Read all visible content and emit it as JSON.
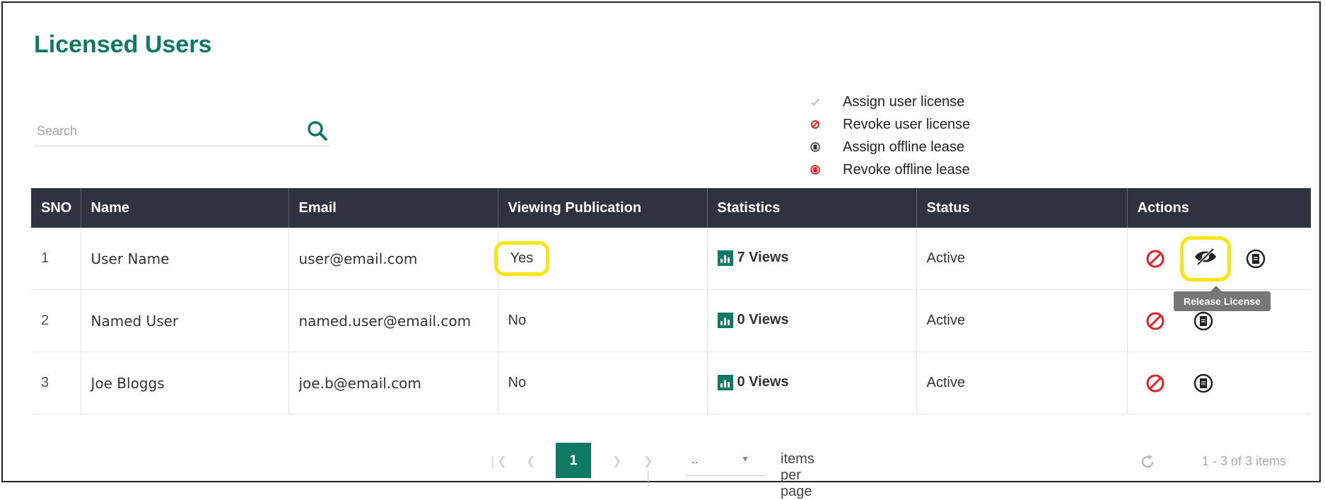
{
  "page": {
    "title": "Licensed Users"
  },
  "search": {
    "placeholder": "Search",
    "value": ""
  },
  "legend": [
    {
      "icon": "check-icon",
      "label": "Assign user license"
    },
    {
      "icon": "revoke-icon",
      "label": "Revoke user license"
    },
    {
      "icon": "offline-lease-icon",
      "label": "Assign offline lease"
    },
    {
      "icon": "revoke-offline-lease-icon",
      "label": "Revoke offline lease"
    }
  ],
  "table": {
    "headers": [
      "SNO",
      "Name",
      "Email",
      "Viewing Publication",
      "Statistics",
      "Status",
      "Actions"
    ],
    "rows": [
      {
        "sno": "1",
        "name": "User Name",
        "email": "user@email.com",
        "viewing": "Yes",
        "statistics": "7 Views",
        "status": "Active"
      },
      {
        "sno": "2",
        "name": "Named User",
        "email": "named.user@email.com",
        "viewing": "No",
        "statistics": "0 Views",
        "status": "Active"
      },
      {
        "sno": "3",
        "name": "Joe Bloggs",
        "email": "joe.b@email.com",
        "viewing": "No",
        "statistics": "0 Views",
        "status": "Active"
      }
    ]
  },
  "tooltip": {
    "text": "Release License"
  },
  "pagination": {
    "current_page": "1",
    "per_page_value": "..",
    "items_per_page_label": "items per page",
    "range_text": "1 - 3 of 3 items"
  },
  "colors": {
    "brand": "#0f7a63",
    "header_bg": "#2f3241",
    "highlight": "#f7e616",
    "revoke": "#e8202a"
  }
}
